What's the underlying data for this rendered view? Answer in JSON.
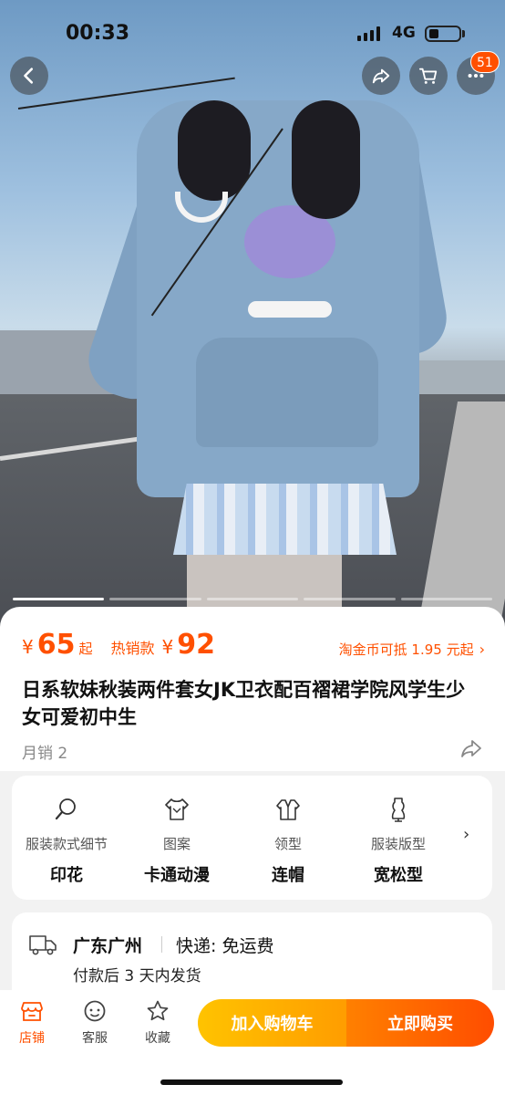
{
  "status_bar": {
    "time": "00:33",
    "network": "4G"
  },
  "nav": {
    "back_icon": "chevron-left-icon",
    "share_icon": "share-icon",
    "cart_icon": "cart-icon",
    "more_icon": "more-icon",
    "cart_badge": "51"
  },
  "carousel": {
    "image_count": 5,
    "active_index": 0
  },
  "product": {
    "currency": "¥",
    "price": "65",
    "price_suffix": "起",
    "hot_label": "热销款",
    "hot_currency": "¥",
    "hot_price": "92",
    "coin_text": "淘金币可抵 1.95 元起",
    "title": "日系软妹秋装两件套女JK卫衣配百褶裙学院风学生少女可爱初中生",
    "monthly_sales": "月销 2"
  },
  "attributes": [
    {
      "icon": "magnifier-icon",
      "label": "服装款式细节",
      "value": "印花"
    },
    {
      "icon": "shirt-pattern-icon",
      "label": "图案",
      "value": "卡通动漫"
    },
    {
      "icon": "collar-icon",
      "label": "领型",
      "value": "连帽"
    },
    {
      "icon": "dress-form-icon",
      "label": "服装版型",
      "value": "宽松型"
    }
  ],
  "shipping": {
    "location": "广东广州",
    "express": "快递: 免运费",
    "delivery": "付款后 3 天内发货"
  },
  "bottom_bar": {
    "tabs": [
      {
        "icon": "store-icon",
        "label": "店铺"
      },
      {
        "icon": "service-icon",
        "label": "客服"
      },
      {
        "icon": "star-icon",
        "label": "收藏"
      }
    ],
    "add_to_cart": "加入购物车",
    "buy_now": "立即购买"
  },
  "colors": {
    "accent": "#ff5000",
    "add_cart_gradient": [
      "#ffc300",
      "#ff9d00"
    ],
    "buy_gradient": [
      "#ff8000",
      "#ff4d00"
    ]
  }
}
